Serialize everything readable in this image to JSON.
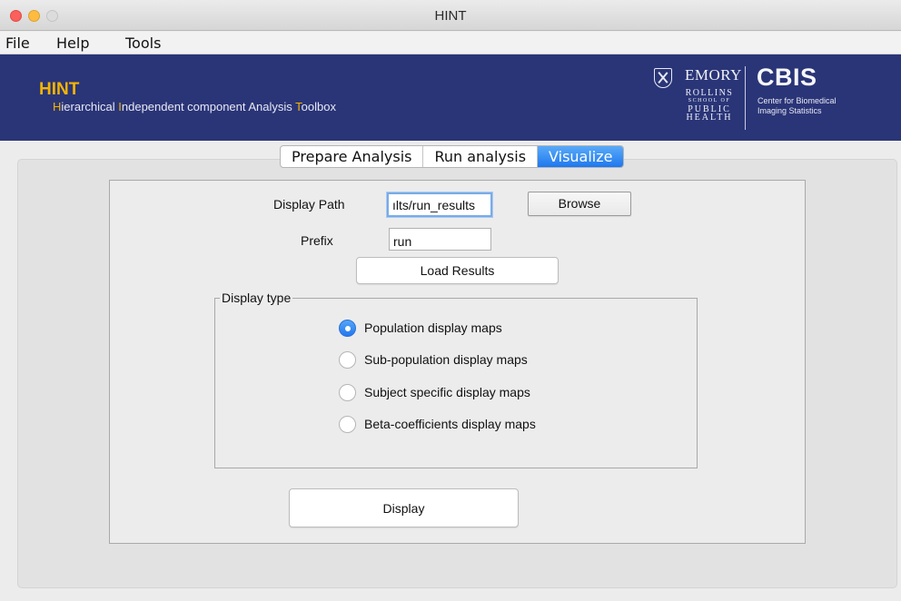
{
  "window": {
    "title": "HINT"
  },
  "menu": {
    "items": [
      "File",
      "Help",
      "Tools"
    ]
  },
  "banner": {
    "title": "HINT",
    "subtitle": {
      "p1": "H",
      "p2": "ierarchical ",
      "p3": "I",
      "p4": "ndependent component Analysis ",
      "p5": "T",
      "p6": "oolbox"
    },
    "emory": {
      "name": "EMORY",
      "line1": "ROLLINS",
      "line2": "SCHOOL OF",
      "line3": "PUBLIC",
      "line4": "HEALTH"
    },
    "cbis": {
      "name": "CBIS",
      "line1": "Center for Biomedical",
      "line2": "Imaging Statistics"
    }
  },
  "tabs": [
    {
      "label": "Prepare Analysis",
      "active": false
    },
    {
      "label": "Run analysis",
      "active": false
    },
    {
      "label": "Visualize",
      "active": true
    }
  ],
  "form": {
    "display_path_label": "Display Path",
    "display_path_value": "ılts/run_results",
    "browse_label": "Browse",
    "prefix_label": "Prefix",
    "prefix_value": "run",
    "load_results_label": "Load Results",
    "display_type_title": "Display type",
    "display_type_options": [
      {
        "label": "Population display maps",
        "checked": true
      },
      {
        "label": "Sub-population display maps",
        "checked": false
      },
      {
        "label": "Subject specific display maps",
        "checked": false
      },
      {
        "label": "Beta-coefficients display maps",
        "checked": false
      }
    ],
    "display_button_label": "Display"
  },
  "colors": {
    "banner_bg": "#2a3578",
    "accent_yellow": "#f4b400",
    "tab_active": "#1e78ee",
    "radio_checked": "#2278ee"
  }
}
